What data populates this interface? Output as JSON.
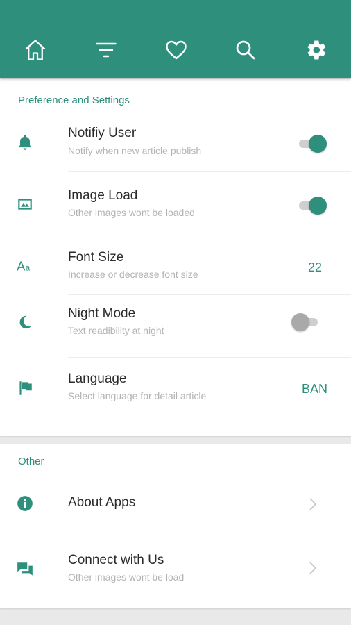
{
  "colors": {
    "accent": "#2e8f7c",
    "header_bg": "#2e8f7c",
    "background": "#e9e9e9",
    "card": "#ffffff",
    "subtitle": "#b3b3b3",
    "toggle_off_knob": "#a9a9a9"
  },
  "nav": {
    "items": [
      {
        "icon": "home-icon",
        "active": false
      },
      {
        "icon": "filter-icon",
        "active": false
      },
      {
        "icon": "heart-icon",
        "active": false
      },
      {
        "icon": "search-icon",
        "active": false
      },
      {
        "icon": "gear-icon",
        "active": true
      }
    ]
  },
  "settings": {
    "section_title": "Preference and Settings",
    "notify": {
      "icon": "bell-icon",
      "title": "Notifiy User",
      "subtitle": "Notify when new article publish",
      "enabled": true
    },
    "image_load": {
      "icon": "image-icon",
      "title": "Image Load",
      "subtitle": "Other images wont be loaded",
      "enabled": true
    },
    "font_size": {
      "icon": "font-size-icon",
      "title": "Font Size",
      "subtitle": "Increase or decrease font size",
      "value": "22"
    },
    "night_mode": {
      "icon": "moon-icon",
      "title": "Night Mode",
      "subtitle": "Text readibility at night",
      "enabled": false
    },
    "language": {
      "icon": "flag-icon",
      "title": "Language",
      "subtitle": "Select language for detail article",
      "value": "BAN"
    }
  },
  "other": {
    "section_title": "Other",
    "about": {
      "icon": "info-icon",
      "title": "About Apps"
    },
    "connect": {
      "icon": "chat-icon",
      "title": "Connect with Us",
      "subtitle": "Other images wont be load"
    }
  }
}
